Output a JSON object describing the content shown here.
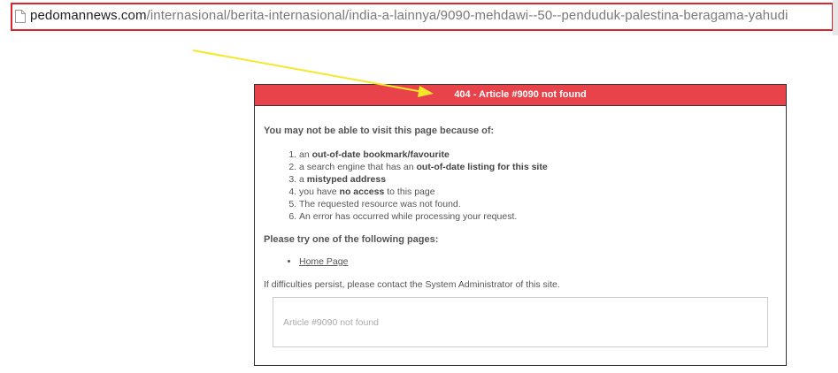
{
  "browser": {
    "url_domain": "pedomannews.com",
    "url_path": "/internasional/berita-internasional/india-a-lainnya/9090-mehdawi--50--penduduk-palestina-beragama-yahudi"
  },
  "annotation": {
    "arrow_color": "#f5e829",
    "highlight_color": "#d9272e"
  },
  "error_page": {
    "title": "404 - Article #9090 not found",
    "header_color": "#e8434b",
    "reason_heading": "You may not be able to visit this page because of:",
    "reasons": [
      {
        "pre": "an ",
        "bold": "out-of-date bookmark/favourite",
        "post": ""
      },
      {
        "pre": "a search engine that has an ",
        "bold": "out-of-date listing for this site",
        "post": ""
      },
      {
        "pre": "a ",
        "bold": "mistyped address",
        "post": ""
      },
      {
        "pre": "you have ",
        "bold": "no access",
        "post": " to this page"
      },
      {
        "pre": "The requested resource was not found.",
        "bold": "",
        "post": ""
      },
      {
        "pre": "An error has occurred while processing your request.",
        "bold": "",
        "post": ""
      }
    ],
    "try_heading": "Please try one of the following pages:",
    "pages": [
      "Home Page"
    ],
    "contact_note": "If difficulties persist, please contact the System Administrator of this site.",
    "error_detail": "Article #9090 not found"
  }
}
